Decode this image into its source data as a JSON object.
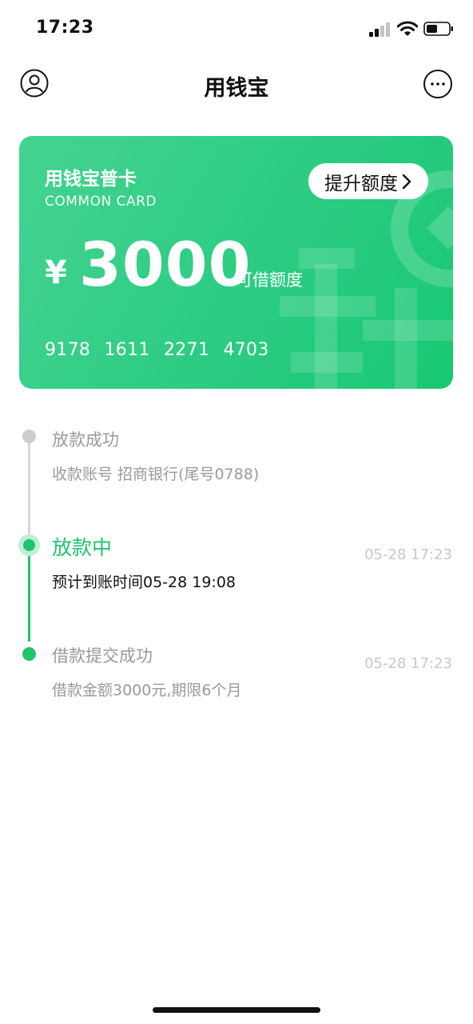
{
  "status_bar": {
    "time": "17:23"
  },
  "nav": {
    "title": "用钱宝"
  },
  "card": {
    "name": "用钱宝普卡",
    "subname": "COMMON CARD",
    "raise_label": "提升额度",
    "currency": "¥",
    "amount": "3000",
    "amount_label": "可借额度",
    "number": "9178 1611 2271 4703"
  },
  "timeline": [
    {
      "title": "放款成功",
      "desc": "收款账号 招商银行(尾号0788)",
      "time": ""
    },
    {
      "title": "放款中",
      "desc": "预计到账时间05-28 19:08",
      "time": "05-28 17:23"
    },
    {
      "title": "借款提交成功",
      "desc": "借款金额3000元,期限6个月",
      "time": "05-28 17:23"
    }
  ],
  "colors": {
    "accent": "#1fc46e",
    "card_start": "#44d391",
    "card_end": "#18c872",
    "muted": "#9a9a9a"
  }
}
